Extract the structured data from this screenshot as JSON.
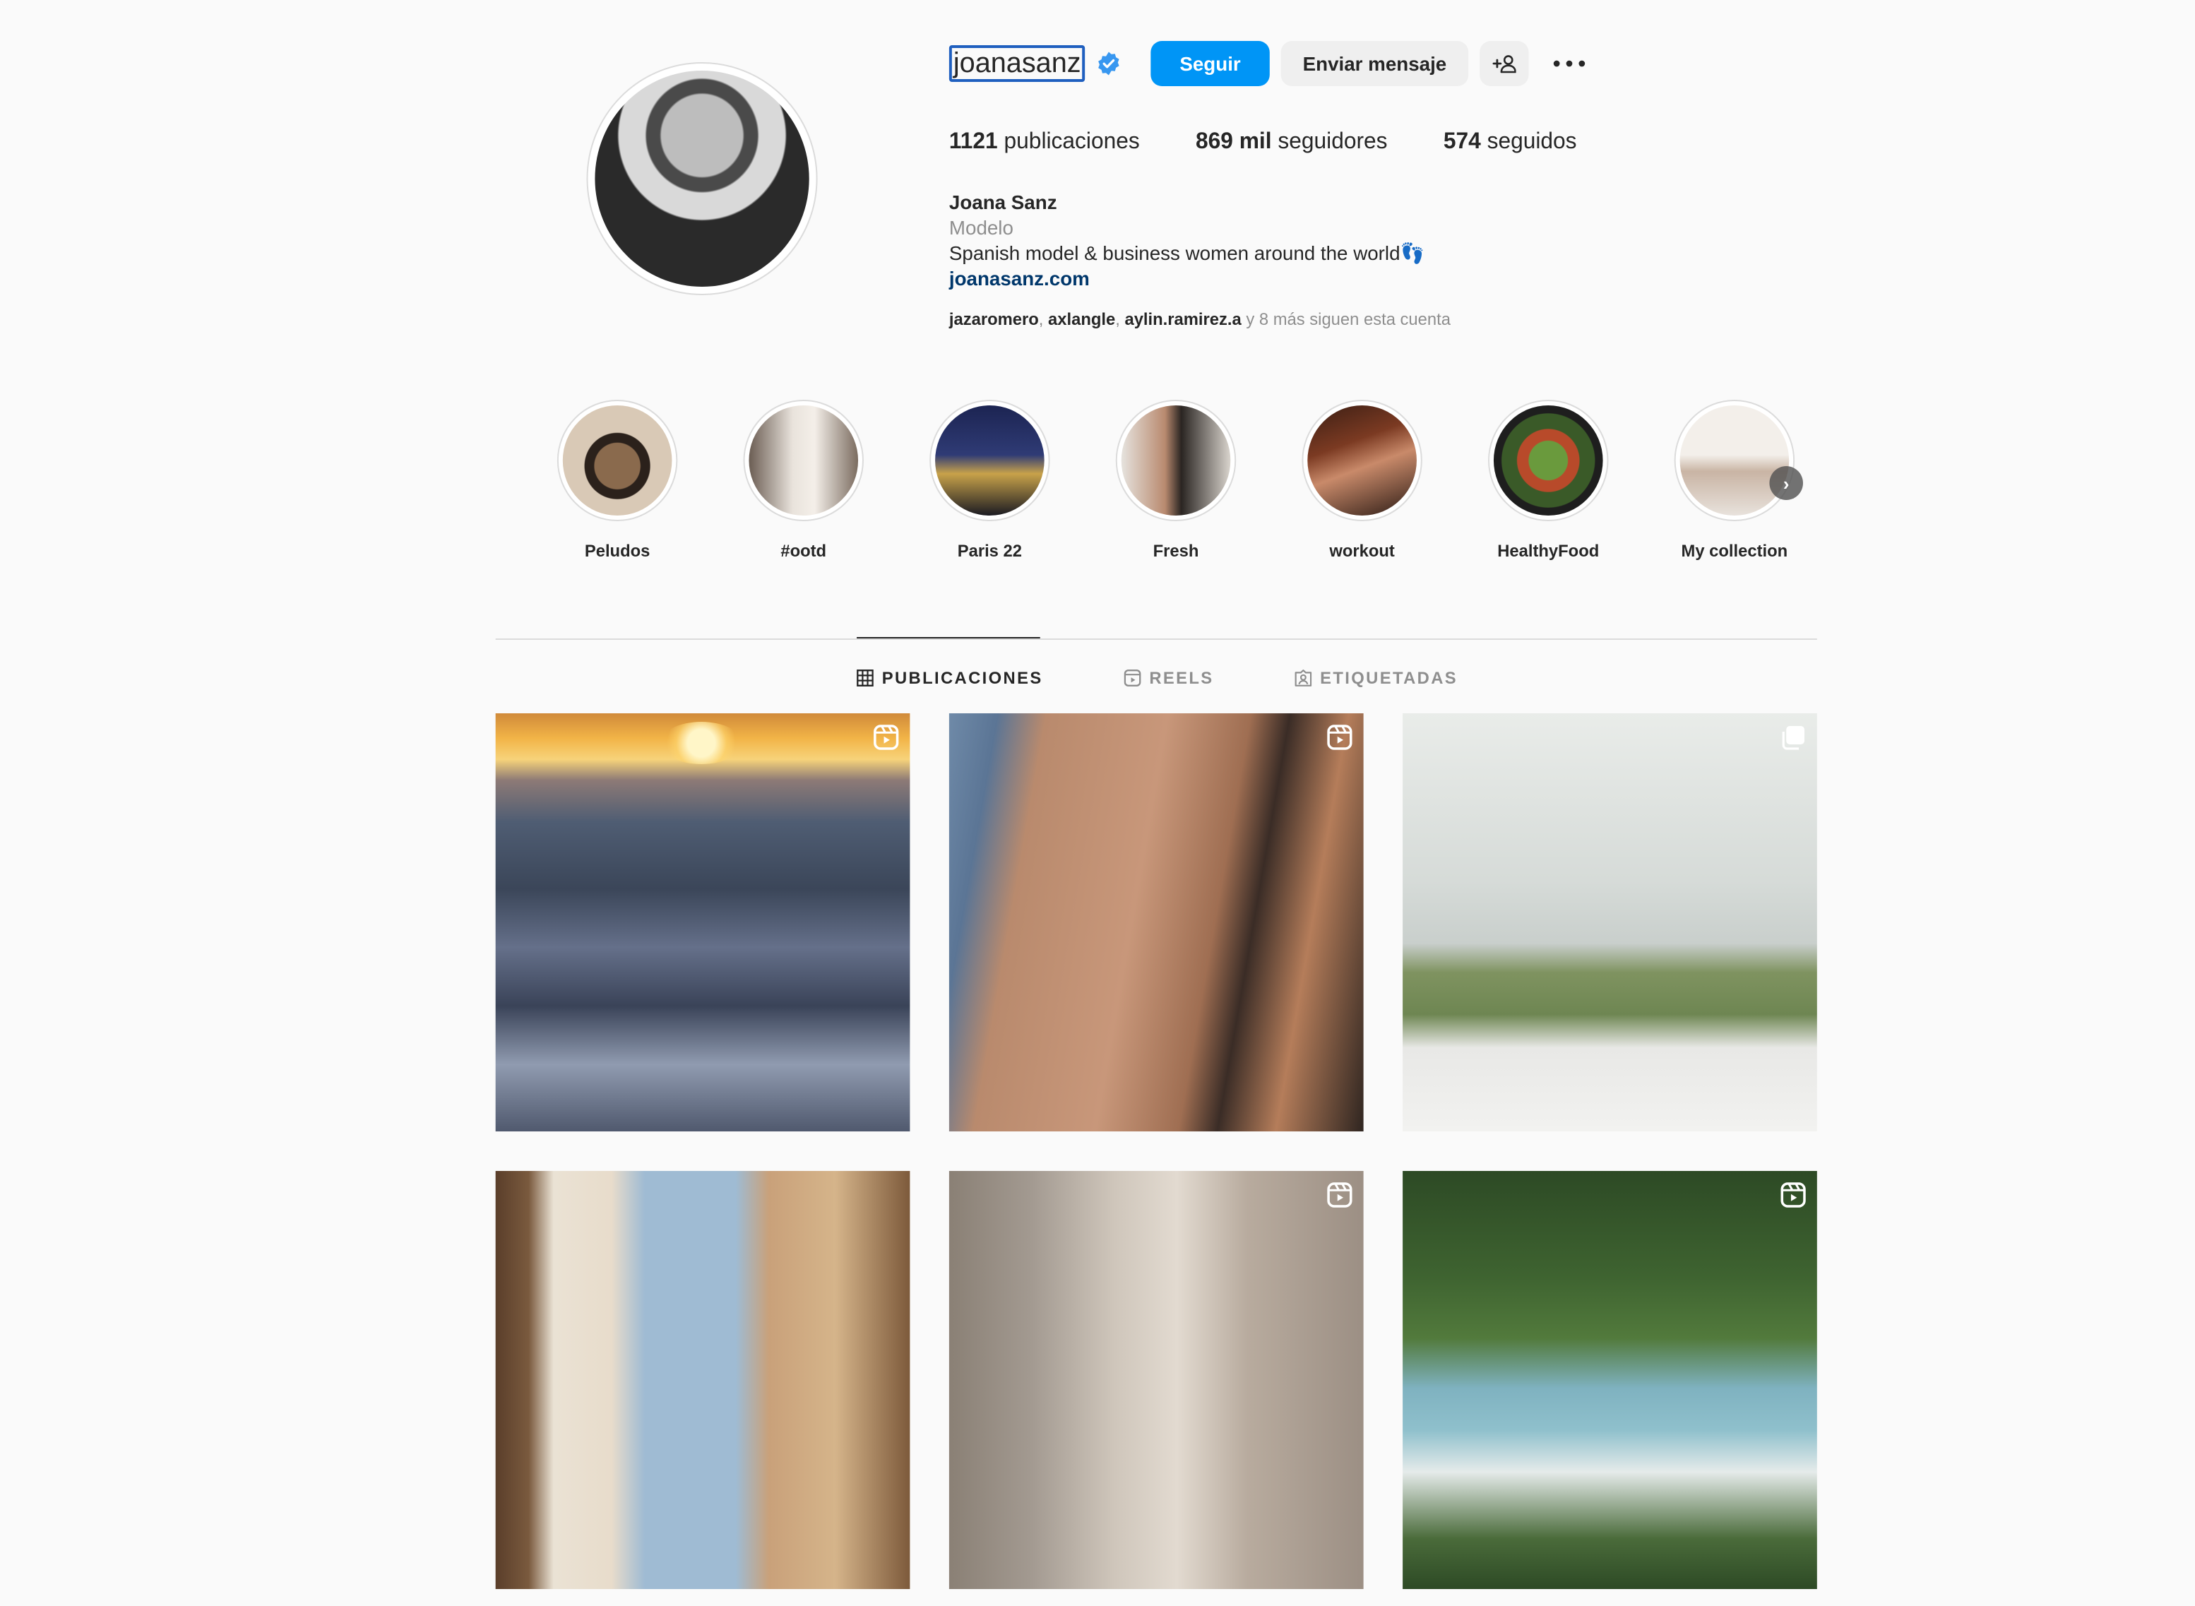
{
  "profile": {
    "username": "joanasanz",
    "verified": true,
    "follow_label": "Seguir",
    "message_label": "Enviar mensaje",
    "stats": {
      "posts_count": "1121",
      "posts_label": "publicaciones",
      "followers_count": "869 mil",
      "followers_label": "seguidores",
      "following_count": "574",
      "following_label": "seguidos"
    },
    "bio": {
      "name": "Joana Sanz",
      "category": "Modelo",
      "description": "Spanish model & business women around the world👣",
      "link": "joanasanz.com"
    },
    "followed_by": {
      "users": [
        "jazaromero",
        "axlangle",
        "aylin.ramirez.a"
      ],
      "separator": ", ",
      "suffix": "y 8 más siguen esta cuenta"
    }
  },
  "highlights": [
    {
      "label": "Peludos"
    },
    {
      "label": "#ootd"
    },
    {
      "label": "Paris 22"
    },
    {
      "label": "Fresh"
    },
    {
      "label": "workout"
    },
    {
      "label": "HealthyFood"
    },
    {
      "label": "My collection"
    }
  ],
  "tabs": [
    {
      "label": "PUBLICACIONES",
      "icon": "grid-icon",
      "active": true
    },
    {
      "label": "REELS",
      "icon": "reels-icon",
      "active": false
    },
    {
      "label": "ETIQUETADAS",
      "icon": "tagged-icon",
      "active": false
    }
  ],
  "posts": [
    {
      "type": "reel",
      "icon": "reel-badge-icon"
    },
    {
      "type": "reel",
      "icon": "reel-badge-icon"
    },
    {
      "type": "carousel",
      "icon": "carousel-badge-icon"
    },
    {
      "type": "photo",
      "icon": ""
    },
    {
      "type": "reel",
      "icon": "reel-badge-icon"
    },
    {
      "type": "reel",
      "icon": "reel-badge-icon"
    }
  ],
  "colors": {
    "accent": "#0095f6",
    "link": "#00376b",
    "verified": "#3897f0",
    "muted": "#8e8e8e",
    "text": "#262626"
  }
}
